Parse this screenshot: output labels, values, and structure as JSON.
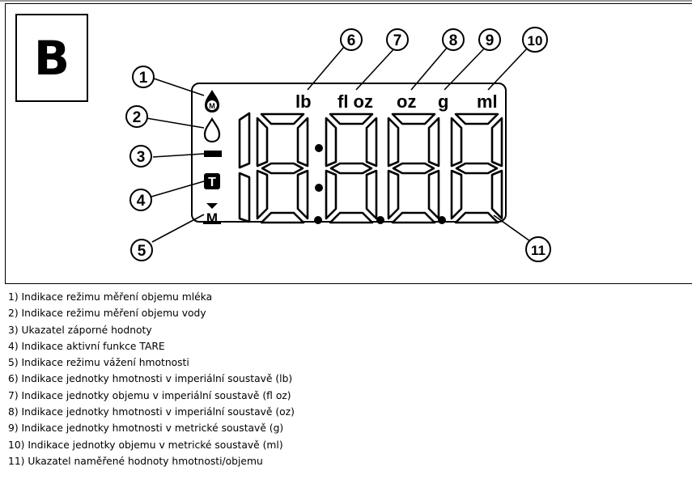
{
  "panel": {
    "label": "B"
  },
  "lcd": {
    "digits": "18:8.8.8",
    "unit_labels": [
      {
        "text": "lb"
      },
      {
        "text": "fl oz"
      },
      {
        "text": "oz"
      },
      {
        "text": "g"
      },
      {
        "text": "ml"
      }
    ]
  },
  "callouts": [
    "1",
    "2",
    "3",
    "4",
    "5",
    "6",
    "7",
    "8",
    "9",
    "10",
    "11"
  ],
  "legend": [
    "1) Indikace režimu měření objemu mléka",
    "2) Indikace režimu měření objemu vody",
    "3) Ukazatel záporné hodnoty",
    "4) Indikace aktivní funkce TARE",
    "5) Indikace režimu vážení hmotnosti",
    "6) Indikace jednotky hmotnosti v imperiální soustavě (lb)",
    "7) Indikace jednotky objemu v imperiální soustavě (fl oz)",
    "8) Indikace jednotky hmotnosti v imperiální soustavě (oz)",
    "9) Indikace jednotky hmotnosti v metrické soustavě (g)",
    "10) Indikace jednotky objemu v metrické soustavě (ml)",
    "11) Ukazatel naměřené hodnoty hmotnosti/objemu"
  ]
}
